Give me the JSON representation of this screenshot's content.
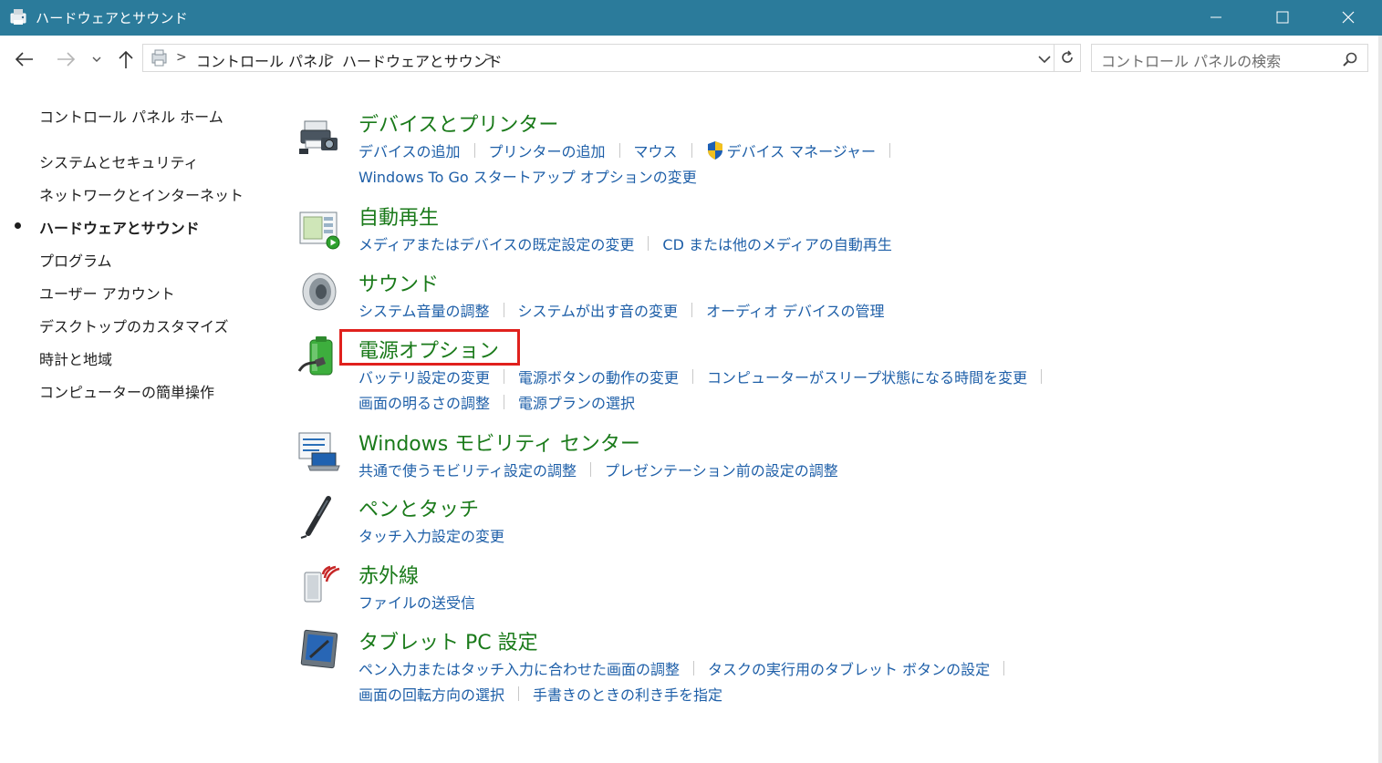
{
  "window": {
    "title": "ハードウェアとサウンド",
    "title_color": "#2b7b9b"
  },
  "address_bar": {
    "crumbs": [
      "コントロール パネル",
      "ハードウェアとサウンド"
    ],
    "separator": ">"
  },
  "search": {
    "placeholder": "コントロール パネルの検索"
  },
  "left_nav": {
    "items": [
      {
        "label": "コントロール パネル ホーム",
        "current": false
      },
      {
        "label": "システムとセキュリティ",
        "current": false
      },
      {
        "label": "ネットワークとインターネット",
        "current": false
      },
      {
        "label": "ハードウェアとサウンド",
        "current": true
      },
      {
        "label": "プログラム",
        "current": false
      },
      {
        "label": "ユーザー アカウント",
        "current": false
      },
      {
        "label": "デスクトップのカスタマイズ",
        "current": false
      },
      {
        "label": "時計と地域",
        "current": false
      },
      {
        "label": "コンピューターの簡単操作",
        "current": false
      }
    ]
  },
  "categories": [
    {
      "title": "デバイスとプリンター",
      "icon": "devices-printers-icon",
      "lines": [
        [
          "デバイスの追加",
          "プリンターの追加",
          "マウス",
          "デバイス マネージャー"
        ],
        [
          "Windows To Go スタートアップ オプションの変更"
        ]
      ]
    },
    {
      "title": "自動再生",
      "icon": "autoplay-icon",
      "lines": [
        [
          "メディアまたはデバイスの既定設定の変更",
          "CD または他のメディアの自動再生"
        ]
      ]
    },
    {
      "title": "サウンド",
      "icon": "speaker-icon",
      "lines": [
        [
          "システム音量の調整",
          "システムが出す音の変更",
          "オーディオ デバイスの管理"
        ]
      ]
    },
    {
      "title": "電源オプション",
      "icon": "battery-plug-icon",
      "lines": [
        [
          "バッテリ設定の変更",
          "電源ボタンの動作の変更",
          "コンピューターがスリープ状態になる時間を変更"
        ],
        [
          "画面の明るさの調整",
          "電源プランの選択"
        ]
      ]
    },
    {
      "title": "Windows モビリティ センター",
      "icon": "mobility-center-icon",
      "lines": [
        [
          "共通で使うモビリティ設定の調整",
          "プレゼンテーション前の設定の調整"
        ]
      ]
    },
    {
      "title": "ペンとタッチ",
      "icon": "pen-icon",
      "lines": [
        [
          "タッチ入力設定の変更"
        ]
      ]
    },
    {
      "title": "赤外線",
      "icon": "infrared-icon",
      "lines": [
        [
          "ファイルの送受信"
        ]
      ]
    },
    {
      "title": "タブレット PC 設定",
      "icon": "tablet-icon",
      "lines": [
        [
          "ペン入力またはタッチ入力に合わせた画面の調整",
          "タスクの実行用のタブレット ボタンの設定"
        ],
        [
          "画面の回転方向の選択",
          "手書きのときの利き手を指定"
        ]
      ]
    }
  ],
  "colors": {
    "category_title": "#1a7a1a",
    "link": "#1e5fa8",
    "highlight_box": "#e0211d"
  }
}
